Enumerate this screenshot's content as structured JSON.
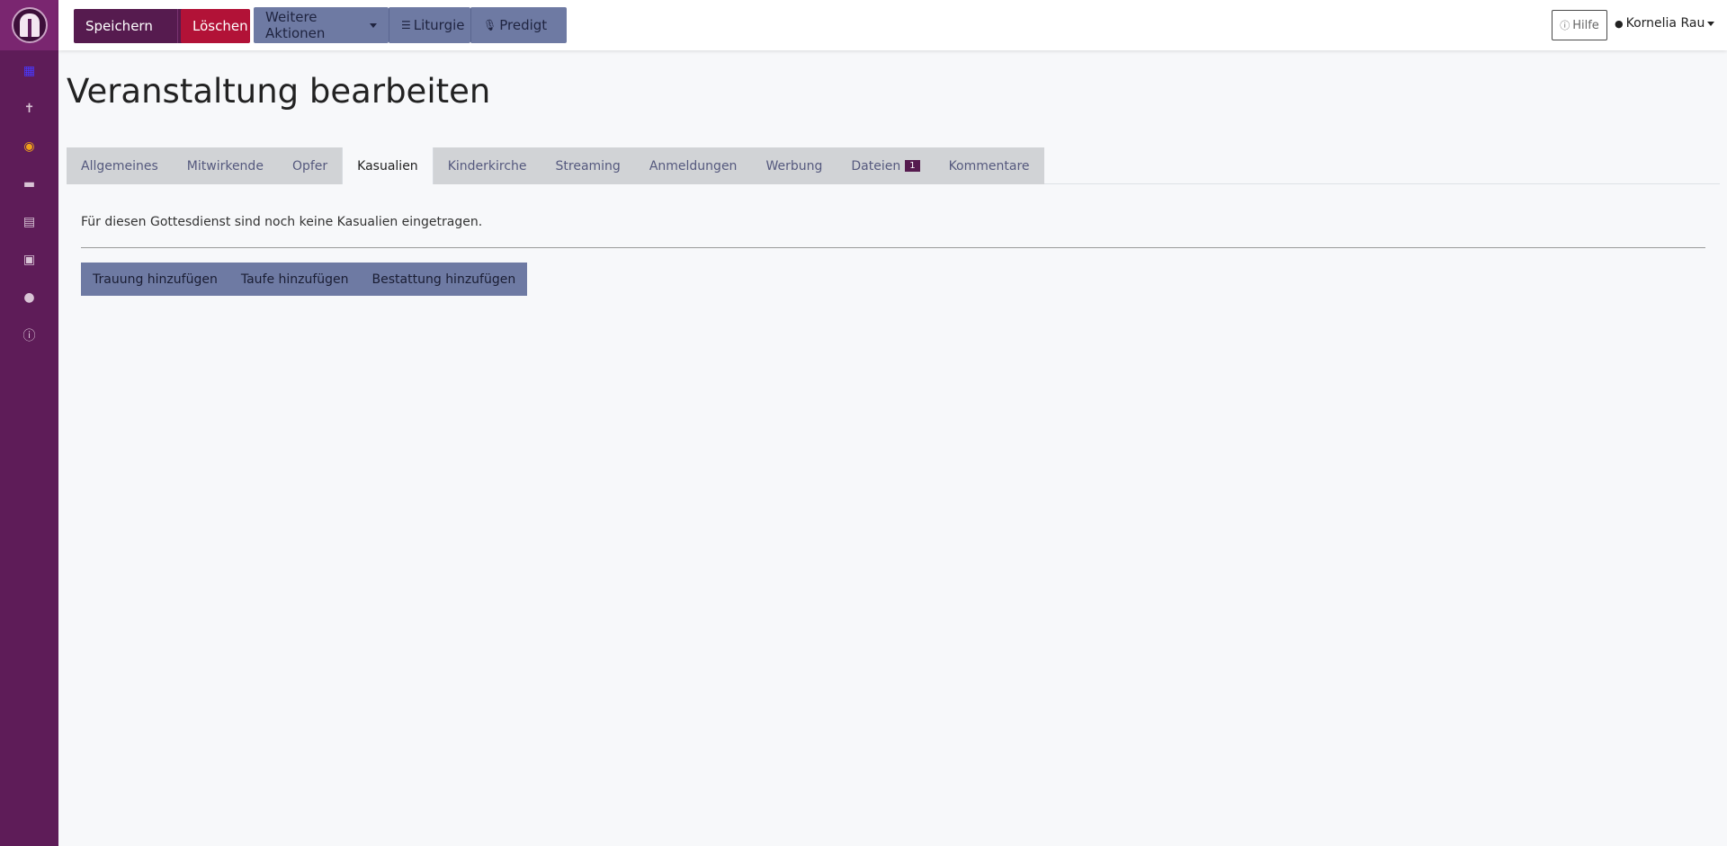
{
  "sidebar": {
    "items": [
      {
        "icon": "calendar-icon"
      },
      {
        "icon": "cross-icon"
      },
      {
        "icon": "globe-icon"
      },
      {
        "icon": "keyboard-icon"
      },
      {
        "icon": "printer-icon"
      },
      {
        "icon": "calendar-check-icon"
      },
      {
        "icon": "user-shield-icon"
      },
      {
        "icon": "info-icon"
      }
    ]
  },
  "toolbar": {
    "save_label": "Speichern",
    "delete_label": "Löschen",
    "more_label": "Weitere Aktionen",
    "liturgie_label": "Liturgie",
    "predigt_label": "Predigt",
    "help_label": "Hilfe",
    "user_name": "Kornelia Rau"
  },
  "page": {
    "title": "Veranstaltung bearbeiten"
  },
  "tabs": [
    {
      "label": "Allgemeines"
    },
    {
      "label": "Mitwirkende"
    },
    {
      "label": "Opfer"
    },
    {
      "label": "Kasualien"
    },
    {
      "label": "Kinderkirche"
    },
    {
      "label": "Streaming"
    },
    {
      "label": "Anmeldungen"
    },
    {
      "label": "Werbung"
    },
    {
      "label": "Dateien",
      "badge": "1"
    },
    {
      "label": "Kommentare"
    }
  ],
  "kasualien": {
    "empty_text": "Für diesen Gottesdienst sind noch keine Kasualien eingetragen.",
    "add_wedding": "Trauung hinzufügen",
    "add_baptism": "Taufe hinzufügen",
    "add_funeral": "Bestattung hinzufügen"
  },
  "colors": {
    "sidebar": "#5e1c58",
    "primary": "#561b4f",
    "danger": "#b21237",
    "secondary": "#6e7aa3"
  }
}
